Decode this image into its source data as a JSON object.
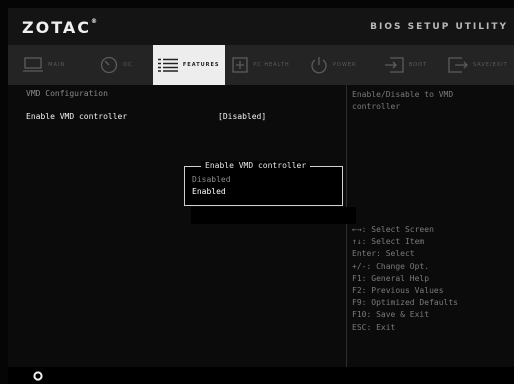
{
  "header": {
    "logo": "ZOTAC",
    "logo_tm": "®",
    "utility_title": "BIOS SETUP UTILITY"
  },
  "tabs": [
    {
      "label": "MAIN",
      "icon": "monitor-icon",
      "active": false
    },
    {
      "label": "OC",
      "icon": "gauge-icon",
      "active": false
    },
    {
      "label": "FEATURES",
      "icon": "list-icon",
      "active": true
    },
    {
      "label": "PC HEALTH",
      "icon": "plus-box-icon",
      "active": false
    },
    {
      "label": "POWER",
      "icon": "power-icon",
      "active": false
    },
    {
      "label": "BOOT",
      "icon": "boot-icon",
      "active": false
    },
    {
      "label": "SAVE/EXIT",
      "icon": "exit-icon",
      "active": false
    }
  ],
  "content": {
    "section_title": "VMD Configuration",
    "option": {
      "label": "Enable VMD controller",
      "value": "[Disabled]"
    }
  },
  "help": {
    "description": "Enable/Disable to VMD controller",
    "keys": [
      "←→: Select Screen",
      "↑↓: Select Item",
      "Enter: Select",
      "+/-: Change Opt.",
      "F1: General Help",
      "F2: Previous Values",
      "F9: Optimized Defaults",
      "F10: Save & Exit",
      "ESC: Exit"
    ]
  },
  "popup": {
    "title": "Enable VMD controller",
    "options": [
      "Disabled",
      "Enabled"
    ],
    "selected_index": 1
  }
}
